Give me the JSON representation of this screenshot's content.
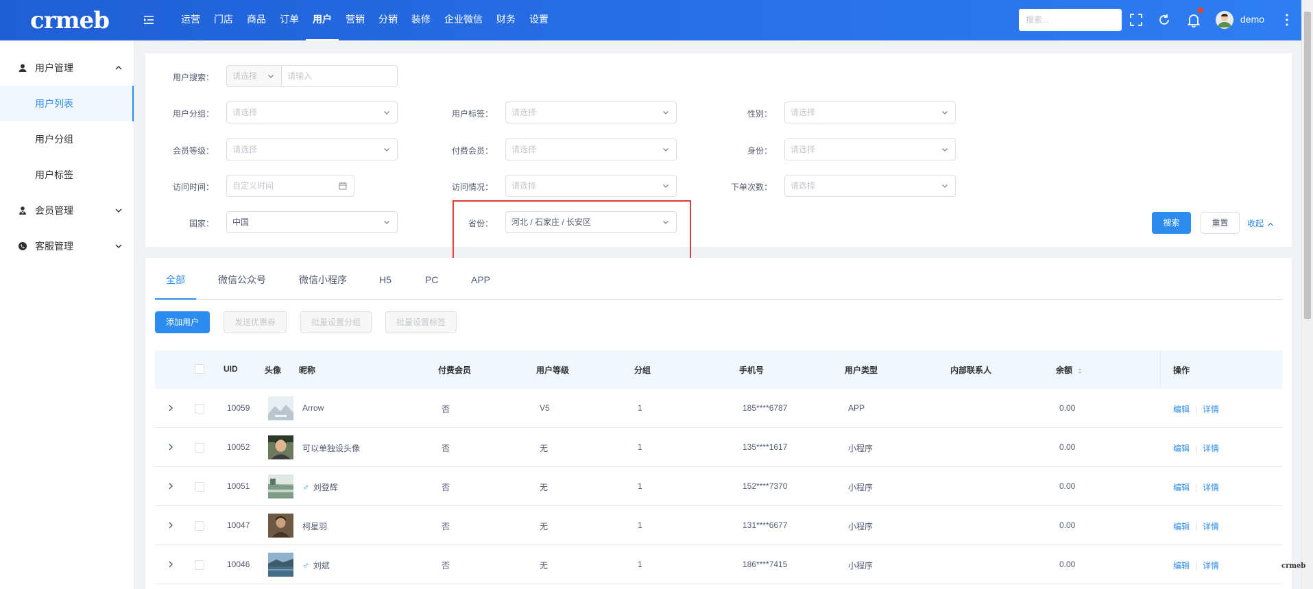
{
  "header": {
    "logo": "crmeb",
    "logo_mark": "®",
    "nav": [
      "运营",
      "门店",
      "商品",
      "订单",
      "用户",
      "营销",
      "分销",
      "装修",
      "企业微信",
      "财务",
      "设置"
    ],
    "active_nav": "用户",
    "search_placeholder": "搜索...",
    "username": "demo",
    "icons": [
      "menu-fold-icon",
      "fullscreen-icon",
      "refresh-icon",
      "bell-icon",
      "more-icon"
    ]
  },
  "sidebar": {
    "groups": [
      {
        "label": "用户管理",
        "icon": "user-icon",
        "expanded": true,
        "items": [
          "用户列表",
          "用户分组",
          "用户标签"
        ],
        "active_item": "用户列表"
      },
      {
        "label": "会员管理",
        "icon": "member-icon",
        "expanded": false
      },
      {
        "label": "客服管理",
        "icon": "service-icon",
        "expanded": false
      }
    ]
  },
  "filters": {
    "user_search": {
      "label": "用户搜索：",
      "select_placeholder": "请选择",
      "input_placeholder": "请输入"
    },
    "user_group": {
      "label": "用户分组：",
      "placeholder": "请选择"
    },
    "user_tag": {
      "label": "用户标签：",
      "placeholder": "请选择"
    },
    "gender": {
      "label": "性别：",
      "placeholder": "请选择"
    },
    "member_level": {
      "label": "会员等级：",
      "placeholder": "请选择"
    },
    "paid_member": {
      "label": "付费会员：",
      "placeholder": "请选择"
    },
    "identity": {
      "label": "身份：",
      "placeholder": "请选择"
    },
    "visit_time": {
      "label": "访问时间：",
      "placeholder": "自定义时间"
    },
    "visit_status": {
      "label": "访问情况：",
      "placeholder": "请选择"
    },
    "order_count": {
      "label": "下单次数：",
      "placeholder": "请选择"
    },
    "country": {
      "label": "国家：",
      "value": "中国"
    },
    "province": {
      "label": "省份：",
      "value": "河北 / 石家庄 / 长安区"
    },
    "search_btn": "搜索",
    "reset_btn": "重置",
    "collapse_link": "收起"
  },
  "tabs": [
    "全部",
    "微信公众号",
    "微信小程序",
    "H5",
    "PC",
    "APP"
  ],
  "active_tab": "全部",
  "actions": {
    "add_user": "添加用户",
    "send_coupon": "发送优惠券",
    "batch_group": "批量设置分组",
    "batch_tag": "批量设置标签"
  },
  "table": {
    "columns": [
      "UID",
      "头像",
      "昵称",
      "付费会员",
      "用户等级",
      "分组",
      "手机号",
      "用户类型",
      "内部联系人",
      "余额",
      "操作"
    ],
    "rows": [
      {
        "uid": "10059",
        "nickname": "Arrow",
        "male": false,
        "paid": "否",
        "level": "V5",
        "group": "1",
        "phone": "185****6787",
        "type": "APP",
        "contact": "",
        "balance": "0.00",
        "avatar": "landscape"
      },
      {
        "uid": "10052",
        "nickname": "可以单独设头像",
        "male": false,
        "paid": "否",
        "level": "无",
        "group": "1",
        "phone": "135****1617",
        "type": "小程序",
        "contact": "",
        "balance": "0.00",
        "avatar": "portrait"
      },
      {
        "uid": "10051",
        "nickname": "刘登辉",
        "male": true,
        "paid": "否",
        "level": "无",
        "group": "1",
        "phone": "152****7370",
        "type": "小程序",
        "contact": "",
        "balance": "0.00",
        "avatar": "river"
      },
      {
        "uid": "10047",
        "nickname": "柯星羽",
        "male": false,
        "paid": "否",
        "level": "无",
        "group": "1",
        "phone": "131****6677",
        "type": "小程序",
        "contact": "",
        "balance": "0.00",
        "avatar": "person"
      },
      {
        "uid": "10046",
        "nickname": "刘斌",
        "male": true,
        "paid": "否",
        "level": "无",
        "group": "1",
        "phone": "186****7415",
        "type": "小程序",
        "contact": "",
        "balance": "0.00",
        "avatar": "lake"
      }
    ],
    "row_actions": [
      "编辑",
      "详情"
    ]
  },
  "watermark": "crmeb",
  "colors": {
    "primary": "#2d8cf0",
    "header_start": "#1f5fd6",
    "header_end": "#2f7df3",
    "highlight": "#e53935"
  }
}
